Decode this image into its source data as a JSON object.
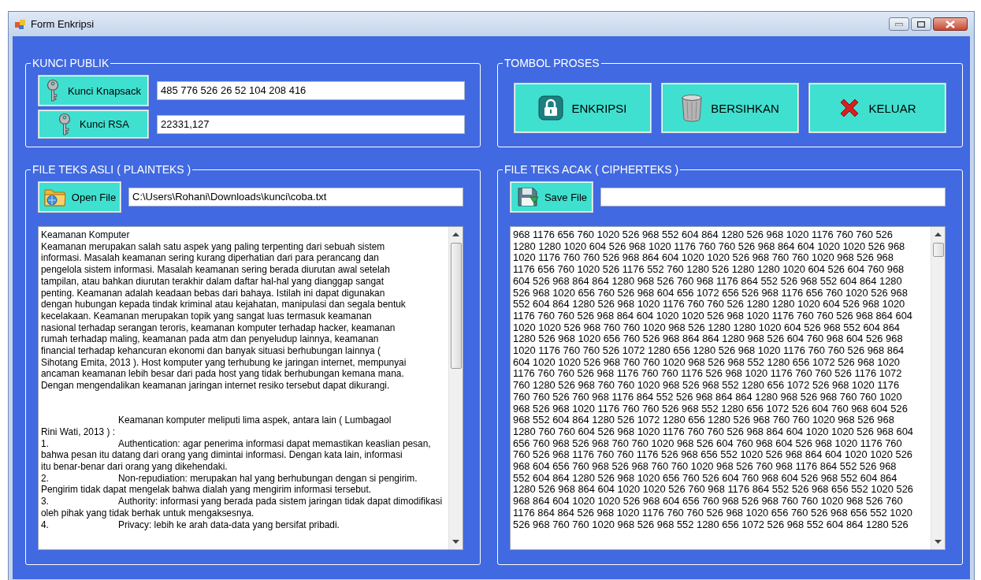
{
  "window": {
    "title": "Form Enkripsi"
  },
  "public_key": {
    "legend": "KUNCI PUBLIK",
    "rows": [
      {
        "button": "Kunci Knapsack",
        "value": "485 776 526 26 52 104 208 416"
      },
      {
        "button": "Kunci RSA",
        "value": "22331,127"
      }
    ]
  },
  "process": {
    "legend": "TOMBOL PROSES",
    "buttons": [
      {
        "label": "ENKRIPSI",
        "kind": "lock"
      },
      {
        "label": "BERSIHKAN",
        "kind": "trash"
      },
      {
        "label": "KELUAR",
        "kind": "exit"
      }
    ]
  },
  "plaintext": {
    "legend": "FILE TEKS ASLI ( PLAINTEKS )",
    "button": "Open File",
    "path": "C:\\Users\\Rohani\\Downloads\\kunci\\coba.txt",
    "text": "Keamanan Komputer\nKeamanan merupakan salah satu aspek yang paling terpenting dari sebuah sistem\ninformasi. Masalah keamanan sering kurang diperhatian dari para perancang dan\npengelola sistem informasi. Masalah keamanan sering berada diurutan awal setelah\ntampilan, atau bahkan diurutan terakhir dalam daftar hal-hal yang dianggap sangat\npenting. Keamanan adalah keadaan bebas dari bahaya. Istilah ini dapat digunakan\ndengan hubungan kepada tindak kriminal atau kejahatan, manipulasi dan segala bentuk\nkecelakaan. Keamanan merupakan topik yang sangat luas termasuk keamanan\nnasional terhadap serangan teroris, keamanan komputer terhadap hacker, keamanan\nrumah terhadap maling, keamanan pada atm dan penyeludup lainnya, keamanan\nfinancial terhadap kehancuran ekonomi dan banyak situasi berhubungan lainnya (\nSihotang Emita, 2013 ). Host komputer yang terhubung ke jaringan internet, mempunyai\nancaman keamanan lebih besar dari pada host yang tidak berhubungan kemana mana.\nDengan mengendalikan keamanan jaringan internet resiko tersebut dapat dikurangi.\n\n\n\tKeamanan komputer meliputi lima aspek, antara lain ( Lumbagaol\nRini Wati, 2013 ) :\n1.\tAuthentication: agar penerima informasi dapat memastikan keaslian pesan,\nbahwa pesan itu datang dari orang yang dimintai informasi. Dengan kata lain, informasi\nitu benar-benar dari orang yang dikehendaki.\n2.\tNon-repudiation: merupakan hal yang berhubungan dengan si pengirim.\nPengirim tidak dapat mengelak bahwa dialah yang mengirim informasi tersebut.\n3.\tAuthority: informasi yang berada pada sistem jaringan tidak dapat dimodifikasi\noleh pihak yang tidak berhak untuk mengaksesnya.\n4.\tPrivacy: lebih ke arah data-data yang bersifat pribadi."
  },
  "ciphertext": {
    "legend": "FILE TEKS ACAK ( CIPHERTEKS )",
    "button": "Save File",
    "text": "968 1176 656 760 1020 526 968 552 604 864 1280 526 968 1020 1176 760 760 526\n1280 1280 1020 604 526 968 1020 1176 760 760 526 968 864 604 1020 1020 526 968\n1020 1176 760 760 526 968 864 604 1020 1020 526 968 760 760 1020 968 526 968\n1176 656 760 1020 526 1176 552 760 1280 526 1280 1280 1020 604 526 604 760 968\n604 526 968 864 864 1280 968 526 760 968 1176 864 552 526 968 552 604 864 1280\n526 968 1020 656 760 526 968 604 656 1072 656 526 968 1176 656 760 1020 526 968\n552 604 864 1280 526 968 1020 1176 760 760 526 1280 1280 1020 604 526 968 1020\n1176 760 760 526 968 864 604 1020 1020 526 968 1020 1176 760 760 526 968 864 604\n1020 1020 526 968 760 760 1020 968 526 1280 1280 1020 604 526 968 552 604 864\n1280 526 968 1020 656 760 526 968 864 864 1280 968 526 604 760 968 604 526 968\n1020 1176 760 760 526 1072 1280 656 1280 526 968 1020 1176 760 760 526 968 864\n604 1020 1020 526 968 760 760 1020 968 526 968 552 1280 656 1072 526 968 1020\n1176 760 760 526 968 1176 760 760 1176 526 968 1020 1176 760 760 526 1176 1072\n760 1280 526 968 760 760 1020 968 526 968 552 1280 656 1072 526 968 1020 1176\n760 760 526 760 968 1176 864 552 526 968 864 864 1280 968 526 968 760 760 1020\n968 526 968 1020 1176 760 760 526 968 552 1280 656 1072 526 604 760 968 604 526\n968 552 604 864 1280 526 1072 1280 656 1280 526 968 760 760 1020 968 526 968\n1280 760 760 604 526 968 1020 1176 760 760 526 968 864 604 1020 1020 526 968 604\n656 760 968 526 968 760 760 1020 968 526 604 760 968 604 526 968 1020 1176 760\n760 526 968 1176 760 760 1176 526 968 656 552 1020 526 968 864 604 1020 1020 526\n968 604 656 760 968 526 968 760 760 1020 968 526 760 968 1176 864 552 526 968\n552 604 864 1280 526 968 1020 656 760 526 604 760 968 604 526 968 552 604 864\n1280 526 968 864 604 1020 1020 526 760 968 1176 864 552 526 968 656 552 1020 526\n968 864 604 1020 1020 526 968 604 656 760 968 526 968 760 760 1020 968 526 760\n1176 864 864 526 968 1020 1176 760 760 526 968 1020 656 760 526 968 656 552 1020\n526 968 760 760 1020 968 526 968 552 1280 656 1072 526 968 552 604 864 1280 526"
  }
}
